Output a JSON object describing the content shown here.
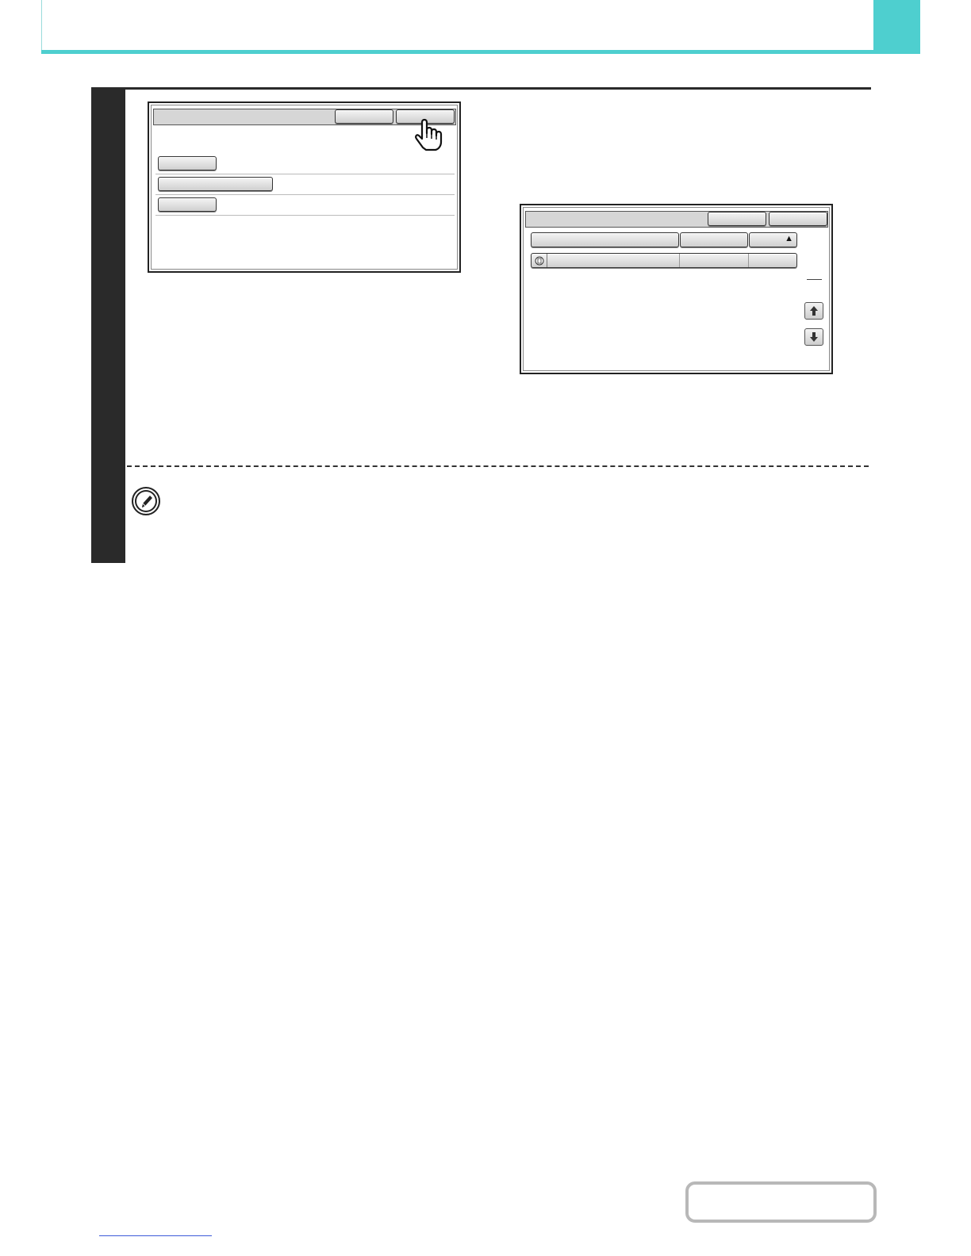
{
  "theme": {
    "accent": "#4ecfcf",
    "step_bar": "#2a2a2a",
    "panel_title": "#d6d6d6",
    "link": "#3d5bd9"
  },
  "icons": {
    "pointer": "hand-pointer-icon",
    "sort": "triangle-up-icon",
    "scroll_up": "arrow-up-icon",
    "scroll_down": "arrow-down-icon",
    "note": "pencil-icon",
    "row": "document-icon"
  },
  "glyphs": {
    "sort_arrow": "▲"
  },
  "contents_button": {
    "label": ""
  }
}
